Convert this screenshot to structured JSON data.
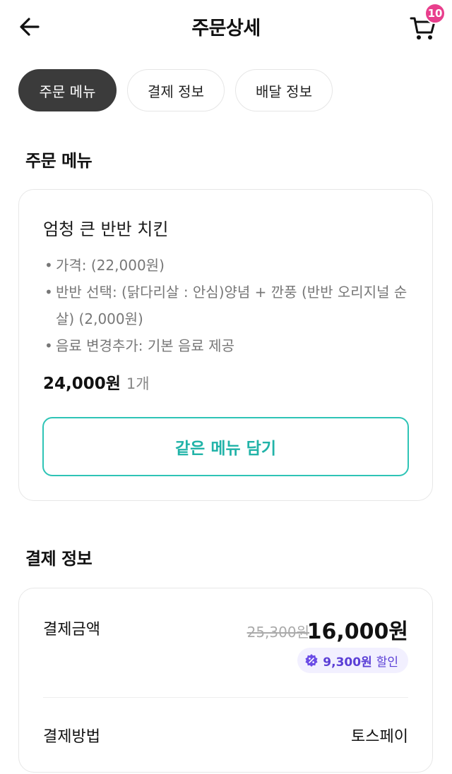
{
  "header": {
    "title": "주문상세",
    "cart_count": "10"
  },
  "tabs": [
    {
      "label": "주문 메뉴",
      "active": true
    },
    {
      "label": "결제 정보",
      "active": false
    },
    {
      "label": "배달 정보",
      "active": false
    }
  ],
  "order_menu": {
    "section_title": "주문 메뉴",
    "item_name": "엄청 큰 반반 치킨",
    "options": [
      "가격: (22,000원)",
      "반반 선택: (닭다리살 : 안심)양념 + 깐풍 (반반 오리지널 순살) (2,000원)",
      "음료 변경추가: 기본 음료 제공"
    ],
    "price": "24,000원",
    "quantity": "1개",
    "same_menu_button": "같은 메뉴 담기"
  },
  "payment": {
    "section_title": "결제 정보",
    "amount_label": "결제금액",
    "original_price": "25,300원",
    "final_price": "16,000원",
    "discount_amount": "9,300원",
    "discount_text": "할인",
    "method_label": "결제방법",
    "method_value": "토스페이"
  },
  "colors": {
    "accent_teal": "#21b3a8",
    "badge_pink": "#e83e8c",
    "discount_purple": "#5b3fd6",
    "active_tab": "#3b3b3b"
  },
  "icons": {
    "back": "arrow-left-icon",
    "cart": "cart-icon",
    "discount": "discount-percent-icon"
  }
}
